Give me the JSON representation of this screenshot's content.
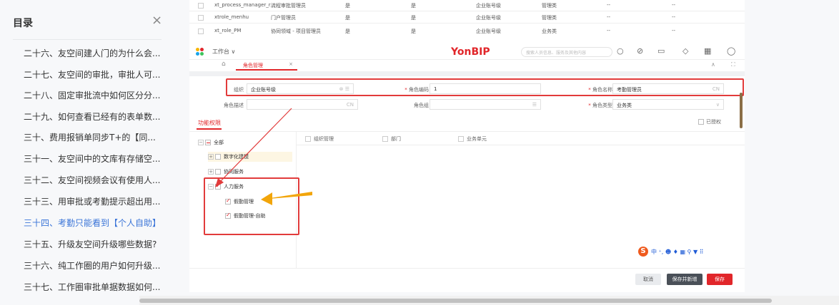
{
  "toc": {
    "title": "目录",
    "items": [
      {
        "label": "二十六、友空间建人门的为什么会..."
      },
      {
        "label": "二十七、友空间的审批，审批人可..."
      },
      {
        "label": "二十八、固定审批流中如何区分分..."
      },
      {
        "label": "二十九、如何查看已经有的表单数..."
      },
      {
        "label": "三十、费用报销单同步T+的【同..."
      },
      {
        "label": "三十一、友空间中的文库有存储空..."
      },
      {
        "label": "三十二、友空间视频会议有使用人..."
      },
      {
        "label": "三十三、用审批或考勤提示超出用..."
      },
      {
        "label": "三十四、考勤只能看到【个人自助】"
      },
      {
        "label": "三十五、升级友空间升级哪些数据?"
      },
      {
        "label": "三十六、纯工作圈的用户如何升级..."
      },
      {
        "label": "三十七、工作圈审批单据数据如何..."
      }
    ],
    "active_index": 8
  },
  "bg_table": {
    "rows": [
      {
        "code": "xt_process_manager_r...",
        "name": "流程审批管理员",
        "f1": "是",
        "f2": "是",
        "org": "企业账号级",
        "type": "管理类",
        "d1": "--",
        "d2": "--"
      },
      {
        "code": "xtrole_menhu",
        "name": "门户管理员",
        "f1": "是",
        "f2": "是",
        "org": "企业账号级",
        "type": "管理类",
        "d1": "--",
        "d2": "--"
      },
      {
        "code": "xt_role_PM",
        "name": "协同领域 - 项目管理员",
        "f1": "是",
        "f2": "是",
        "org": "企业账号级",
        "type": "业务类",
        "d1": "--",
        "d2": "--"
      }
    ]
  },
  "topbar": {
    "workspace": "工作台 ∨",
    "brand": "YonBIP",
    "search_placeholder": "搜索人员信息、服务及其他内容"
  },
  "tab": {
    "label": "角色管理",
    "close": "×"
  },
  "form": {
    "org_label": "组织",
    "org_value": "企业账号级",
    "code_label": "角色编码",
    "code_value": "1",
    "name_label": "角色名称",
    "name_value": "考勤管理员",
    "name_suffix": "CN",
    "desc_label": "角色描述",
    "desc_suffix": "CN",
    "group_label": "角色组",
    "type_label": "角色类型",
    "type_value": "业务类"
  },
  "section": {
    "tab_label": "功能权限",
    "authorized_label": "已授权"
  },
  "tree": {
    "all": "全部",
    "nodes": [
      {
        "label": "数字化建模"
      },
      {
        "label": "协同服务"
      },
      {
        "label": "人力服务"
      },
      {
        "label": "假勤管理"
      },
      {
        "label": "假勤管理-自助"
      }
    ]
  },
  "columns": [
    "组织管理",
    "部门",
    "业务单元"
  ],
  "ime": {
    "logo": "S",
    "text": "中 ⁺, ☻ ♦ ▦ ⚲ ▼ ⠿"
  },
  "buttons": {
    "cancel": "取消",
    "save_new": "保存并新增",
    "save": "保存"
  }
}
